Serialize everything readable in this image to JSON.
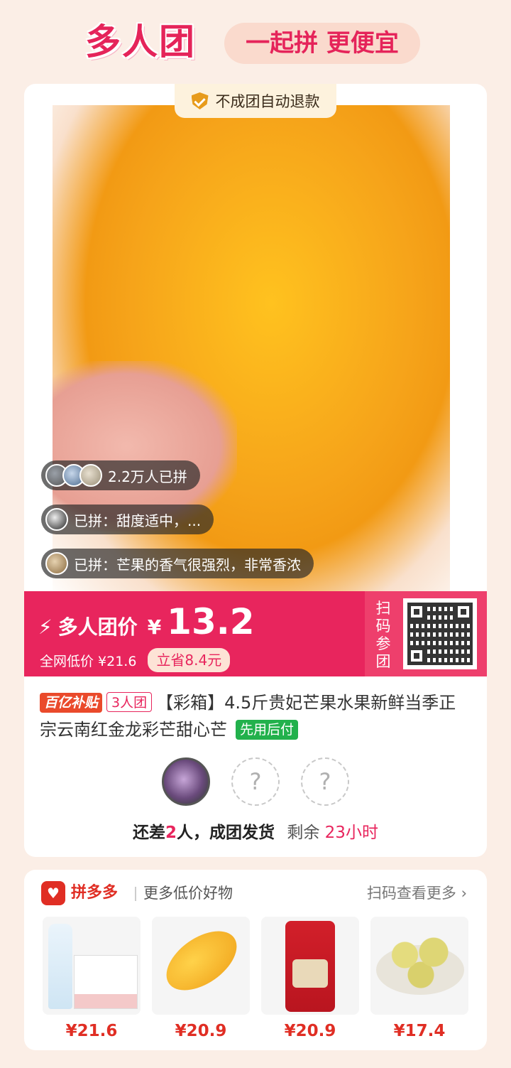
{
  "header": {
    "logo_text": "多人团",
    "slogan": "一起拼 更便宜"
  },
  "product": {
    "refund_badge": "不成团自动退款",
    "joined_count": "2.2万人已拼",
    "reviews": [
      "已拼：甜度适中，...",
      "已拼：芒果的香气很强烈，非常香浓"
    ],
    "image_icon": "mango-product-photo"
  },
  "price": {
    "label": "多人团价",
    "currency": "¥",
    "value": "13.2",
    "lowest_label": "全网低价 ¥21.6",
    "save_tag": "立省8.4元",
    "scan_text": "扫码参团",
    "accent_color": "#e8255d"
  },
  "title": {
    "tag_subsidy": "百亿补贴",
    "tag_group": "3人团",
    "text": "【彩箱】4.5斤贵妃芒果水果新鲜当季正宗云南红金龙彩芒甜心芒",
    "tag_pay": "先用后付"
  },
  "group": {
    "empty_mark": "?",
    "status_prefix": "还差",
    "status_count": "2",
    "status_suffix": "人，成团发货",
    "remaining": "剩余",
    "remaining_time": "23小时"
  },
  "more": {
    "brand": "拼多多",
    "label": "更多低价好物",
    "scan_more": "扫码查看更多",
    "items": [
      {
        "price": "¥21.6",
        "icon": "water-bottle-box"
      },
      {
        "price": "¥20.9",
        "icon": "mango"
      },
      {
        "price": "¥20.9",
        "icon": "rice-bag"
      },
      {
        "price": "¥17.4",
        "icon": "fruit-plate"
      }
    ]
  }
}
